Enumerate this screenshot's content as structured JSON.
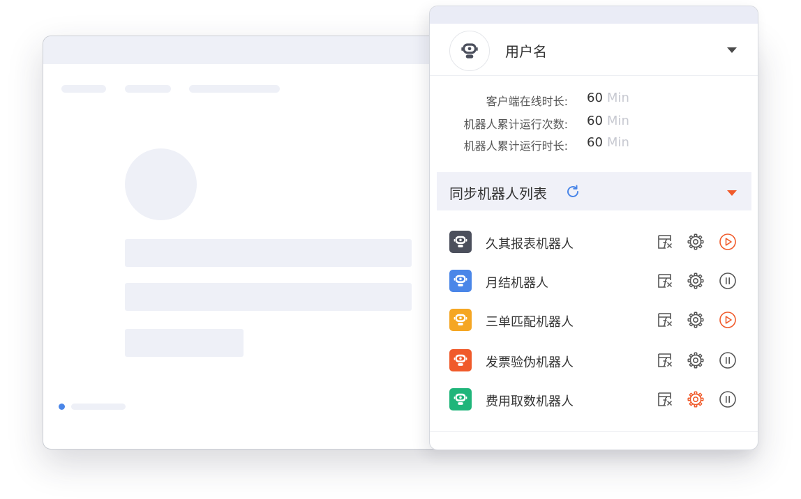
{
  "panel": {
    "username": "用户名",
    "stats": [
      {
        "label": "客户端在线时长:",
        "value": "60",
        "unit": "Min"
      },
      {
        "label": "机器人累计运行次数:",
        "value": "60",
        "unit": "Min"
      },
      {
        "label": "机器人累计运行时长:",
        "value": "60",
        "unit": "Min"
      }
    ],
    "sync_title": "同步机器人列表",
    "robots": [
      {
        "name": "久其报表机器人",
        "color": "#4b4f5c",
        "gear_color": "#555555",
        "state": "play"
      },
      {
        "name": "月结机器人",
        "color": "#4a86e8",
        "gear_color": "#555555",
        "state": "pause"
      },
      {
        "name": "三单匹配机器人",
        "color": "#f5a623",
        "gear_color": "#555555",
        "state": "play"
      },
      {
        "name": "发票验伪机器人",
        "color": "#f05a2a",
        "gear_color": "#555555",
        "state": "pause"
      },
      {
        "name": "费用取数机器人",
        "color": "#1fb57a",
        "gear_color": "#f05a2a",
        "state": "pause"
      }
    ],
    "icons": {
      "avatar": "robot-avatar-icon",
      "dropdown": "caret-down-icon",
      "refresh": "refresh-icon",
      "formula": "formula-fx-icon",
      "settings": "gear-icon",
      "play": "play-circle-icon",
      "pause": "pause-circle-icon"
    },
    "accent": "#f05a2a",
    "refresh_color": "#4a86e8"
  }
}
